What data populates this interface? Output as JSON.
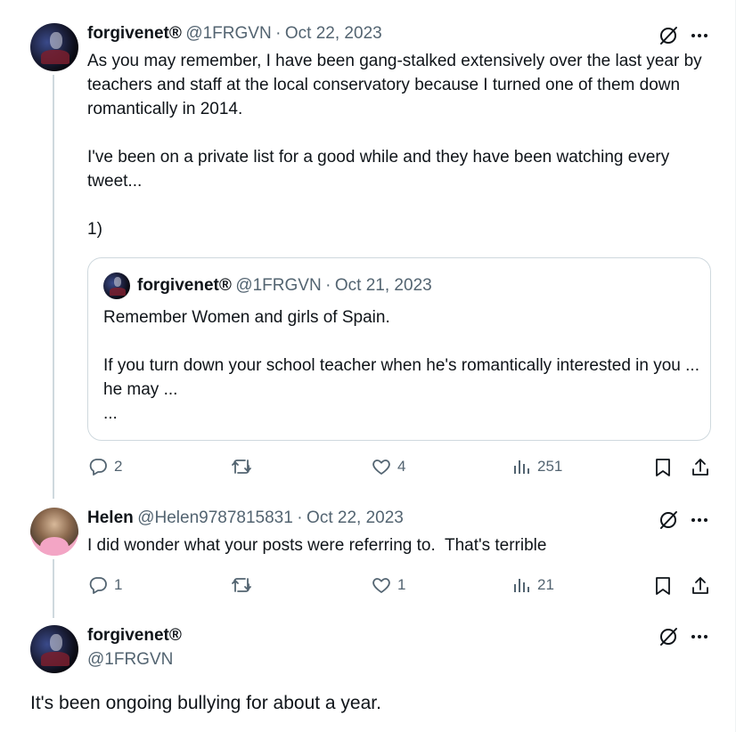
{
  "tweet1": {
    "display_name": "forgivenet®",
    "handle": "@1FRGVN",
    "separator": "·",
    "date": "Oct 22, 2023",
    "text": "As you may remember, I have been gang-stalked extensively over the last year by teachers and staff at the local conservatory because I turned one of them down romantically in 2014.\n\nI've been on a private list for a good while and they have been watching every tweet...\n\n1)",
    "quote": {
      "display_name": "forgivenet®",
      "handle": "@1FRGVN",
      "separator": "·",
      "date": "Oct 21, 2023",
      "text": "Remember Women and girls of Spain.\n\nIf you turn down your school teacher when he's romantically interested in you ... he may ...\n..."
    },
    "actions": {
      "replies": "2",
      "reposts": "",
      "likes": "4",
      "views": "251"
    }
  },
  "tweet2": {
    "display_name": "Helen",
    "handle": "@Helen9787815831",
    "separator": "·",
    "date": "Oct 22, 2023",
    "text": "I did wonder what your posts were referring to.  That's terrible",
    "actions": {
      "replies": "1",
      "reposts": "",
      "likes": "1",
      "views": "21"
    }
  },
  "tweet3": {
    "display_name": "forgivenet®",
    "handle": "@1FRGVN",
    "text": "It's been ongoing bullying for about a year."
  },
  "colors": {
    "text": "#0f1419",
    "secondary": "#536471",
    "border": "#cfd9de"
  },
  "icons": [
    "grok-icon",
    "more-icon",
    "reply-icon",
    "repost-icon",
    "like-icon",
    "views-icon",
    "bookmark-icon",
    "share-icon"
  ]
}
